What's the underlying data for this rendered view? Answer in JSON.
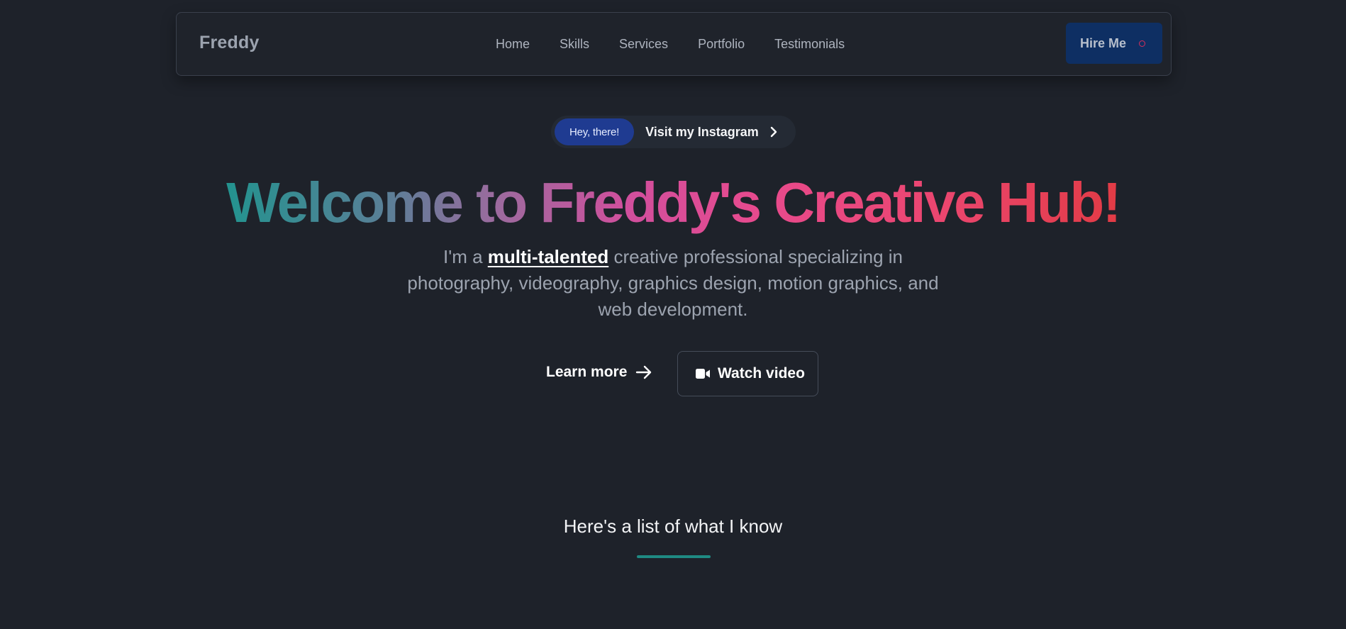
{
  "brand": {
    "name": "Freddy"
  },
  "nav": {
    "links": [
      "Home",
      "Skills",
      "Services",
      "Portfolio",
      "Testimonials"
    ],
    "cta": "Hire Me"
  },
  "hero": {
    "badge": "Hey, there!",
    "badge_link": "Visit my Instagram",
    "title": "Welcome to Freddy's Creative Hub!",
    "subtitle_prefix": "I'm a ",
    "subtitle_emphasis": "multi-talented",
    "subtitle_suffix": " creative professional specializing in photography, videography, graphics design, motion graphics, and web development.",
    "learn_more": "Learn more",
    "watch_video": "Watch video"
  },
  "skills_section": {
    "heading": "Here's a list of what I know"
  },
  "colors": {
    "background": "#1e222a",
    "accent_teal": "#1f8a83",
    "hire_button": "#0e2f63",
    "badge_blue": "#1f3b91",
    "gradient_start": "#23938f",
    "gradient_end": "#e23b45"
  },
  "icons": {
    "pill_arrow": "chevron-right-icon",
    "learn_arrow": "arrow-right-icon",
    "video": "video-camera-icon",
    "hire_indicator": "circle-icon"
  }
}
